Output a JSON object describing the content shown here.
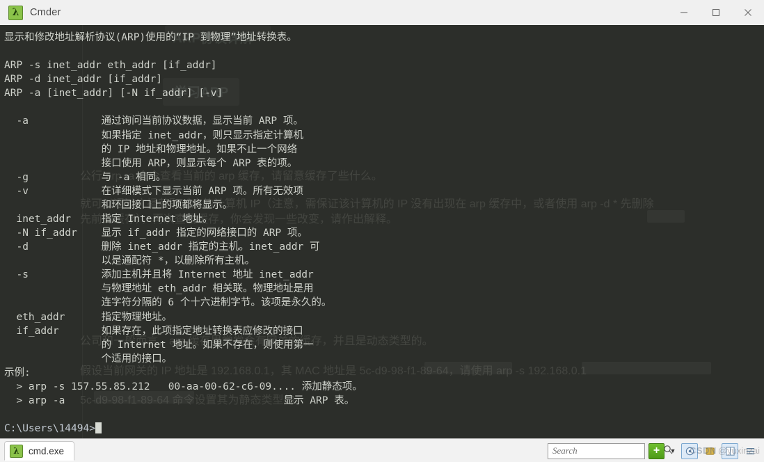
{
  "window": {
    "title": "Cmder",
    "app_icon": "lambda-icon",
    "controls": {
      "minimize": "minimize-icon",
      "maximize": "maximize-icon",
      "close": "close-icon"
    }
  },
  "terminal": {
    "lines": [
      "显示和修改地址解析协议(ARP)使用的“IP 到物理”地址转换表。",
      "",
      "ARP -s inet_addr eth_addr [if_addr]",
      "ARP -d inet_addr [if_addr]",
      "ARP -a [inet_addr] [-N if_addr] [-v]",
      "",
      "  -a            通过询问当前协议数据，显示当前 ARP 项。",
      "                如果指定 inet_addr，则只显示指定计算机",
      "                的 IP 地址和物理地址。如果不止一个网络",
      "                接口使用 ARP，则显示每个 ARP 表的项。",
      "  -g            与 -a 相同。",
      "  -v            在详细模式下显示当前 ARP 项。所有无效项",
      "                和环回接口上的项都将显示。",
      "  inet_addr     指定 Internet 地址。",
      "  -N if_addr    显示 if_addr 指定的网络接口的 ARP 项。",
      "  -d            删除 inet_addr 指定的主机。inet_addr 可",
      "                以是通配符 *，以删除所有主机。",
      "  -s            添加主机并且将 Internet 地址 inet_addr",
      "                与物理地址 eth_addr 相关联。物理地址是用",
      "                连字符分隔的 6 个十六进制字节。该项是永久的。",
      "  eth_addr      指定物理地址。",
      "  if_addr       如果存在，此项指定地址转换表应修改的接口",
      "                的 Internet 地址。如果不存在，则使用第一",
      "                个适用的接口。",
      "示例:",
      "  > arp -s 157.55.85.212   00-aa-00-62-c6-09.... 添加静态项。",
      "  > arp -a                                    显示 ARP 表。",
      ""
    ],
    "prompt": "C:\\Users\\14494>",
    "cursor": "block-cursor"
  },
  "ghost_overlay": {
    "heading": "ARP协议详解",
    "subheading": "学习ARP",
    "lines": [
      "公行 arp -a 命令查看当前的 arp 缓存，请留意缓存了些什么。",
      "就可以通过广播获取对应的计算机 IP（注意，需保证该计算机的 IP 没有出现在 arp 缓存中，或者使用 arp -d * 先删除",
      "先前的缓存），再次查看缓存，你会发现一些改变，请作出解释。",
      "公司和一般而言，arp 缓存里常常会有网关的缓存，并且是动态类型的。",
      "假设当前网关的 IP 地址是 192.168.0.1，其 MAC 地址是 5c-d9-98-f1-89-64，请使用 arp -s 192.168.0.1",
      "5c-d9-98-f1-89-64 命令设置其为静态类型的。"
    ]
  },
  "statusbar": {
    "tab": {
      "label": "cmd.exe",
      "icon": "lambda-icon"
    },
    "search": {
      "placeholder": "Search",
      "value": "",
      "icon": "search-icon"
    },
    "new_console": "+",
    "dropdown": "chevron-down-icon",
    "buttons": [
      "settings-icon",
      "help-icon",
      "layout-icon"
    ]
  },
  "watermark": {
    "brand": "CSDN",
    "user": "@yuxinzai"
  },
  "colors": {
    "terminal_bg": "#2c2e2a",
    "terminal_fg": "#cfd2cb",
    "titlebar_bg": "#f0f0f0",
    "accent_green": "#8bc34a",
    "ghost_green": "#3e7d5e"
  }
}
